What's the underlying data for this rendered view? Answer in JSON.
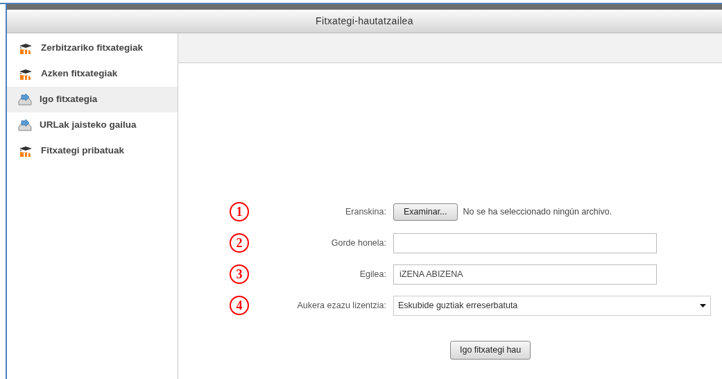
{
  "dialog": {
    "title": "Fitxategi-hautatzailea"
  },
  "sidebar": {
    "items": [
      {
        "label": "Zerbitzariko fitxategiak",
        "kind": "repository",
        "selected": false
      },
      {
        "label": "Azken fitxategiak",
        "kind": "repository",
        "selected": false
      },
      {
        "label": "Igo fitxategia",
        "kind": "upload",
        "selected": true
      },
      {
        "label": "URLak jaisteko gailua",
        "kind": "upload",
        "selected": false
      },
      {
        "label": "Fitxategi pribatuak",
        "kind": "repository",
        "selected": false
      }
    ]
  },
  "form": {
    "rows": [
      {
        "number": "1",
        "label": "Eranskina:",
        "kind": "file",
        "button": "Examinar...",
        "status": "No se ha seleccionado ningún archivo."
      },
      {
        "number": "2",
        "label": "Gorde honela:",
        "kind": "text",
        "value": ""
      },
      {
        "number": "3",
        "label": "Egilea:",
        "kind": "text",
        "value": "iZENA ABIZENA"
      },
      {
        "number": "4",
        "label": "Aukera ezazu lizentzia:",
        "kind": "select",
        "value": "Eskubide guztiak erreserbatuta"
      }
    ],
    "submit": "Igo fitxategi hau"
  }
}
